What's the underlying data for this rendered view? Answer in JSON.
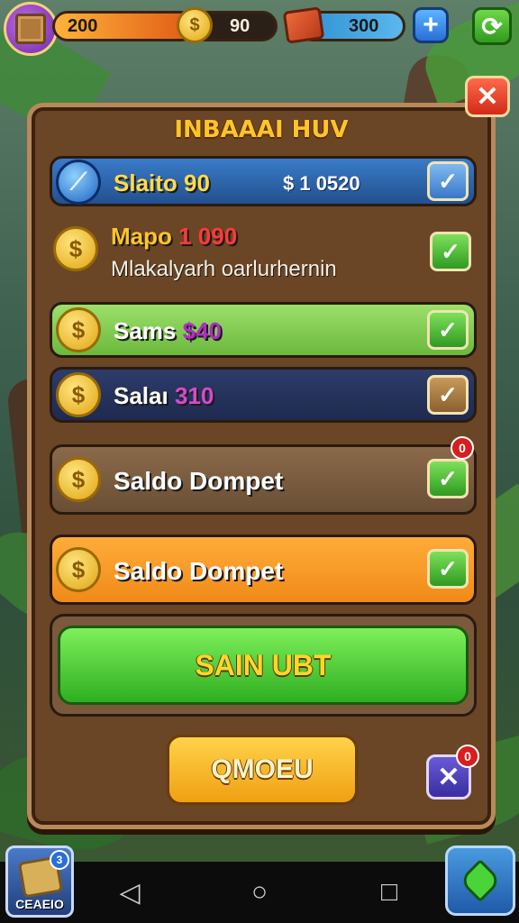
{
  "resources": {
    "crates": "200",
    "coins": "90",
    "coin_symbol": "$",
    "bricks": "300"
  },
  "panel": {
    "title": "INBAAAI HUV",
    "rows": [
      {
        "label": "Slaito 90",
        "price": "$ 1 0520"
      },
      {
        "label_a": "Mapo ",
        "label_num": "1 090",
        "subtitle": "Mlakalyarh oarlurhernin"
      },
      {
        "label_a": "Sams ",
        "label_num": "$40"
      },
      {
        "label_a": "Salaı ",
        "label_num": "310"
      },
      {
        "label": "Saldo Dompet",
        "badge": "0"
      },
      {
        "label": "Saldo Dompet"
      }
    ],
    "primary_button": "SAIN UBT",
    "secondary_button": "QMOEU",
    "close_badge": "0"
  },
  "corner": {
    "left_caption": "CEAEIO",
    "left_badge": "3"
  },
  "colors": {
    "panel_brown": "#6a4526",
    "title_gold": "#ffc42a",
    "check_green": "#2f9a22",
    "primary_green": "#2fae22",
    "secondary_yellow": "#f0a012"
  },
  "icons": {
    "coin": "$",
    "check": "✓",
    "close": "✕",
    "plus": "+",
    "refresh": "⟳",
    "back": "◁",
    "home": "○",
    "recent": "□"
  }
}
